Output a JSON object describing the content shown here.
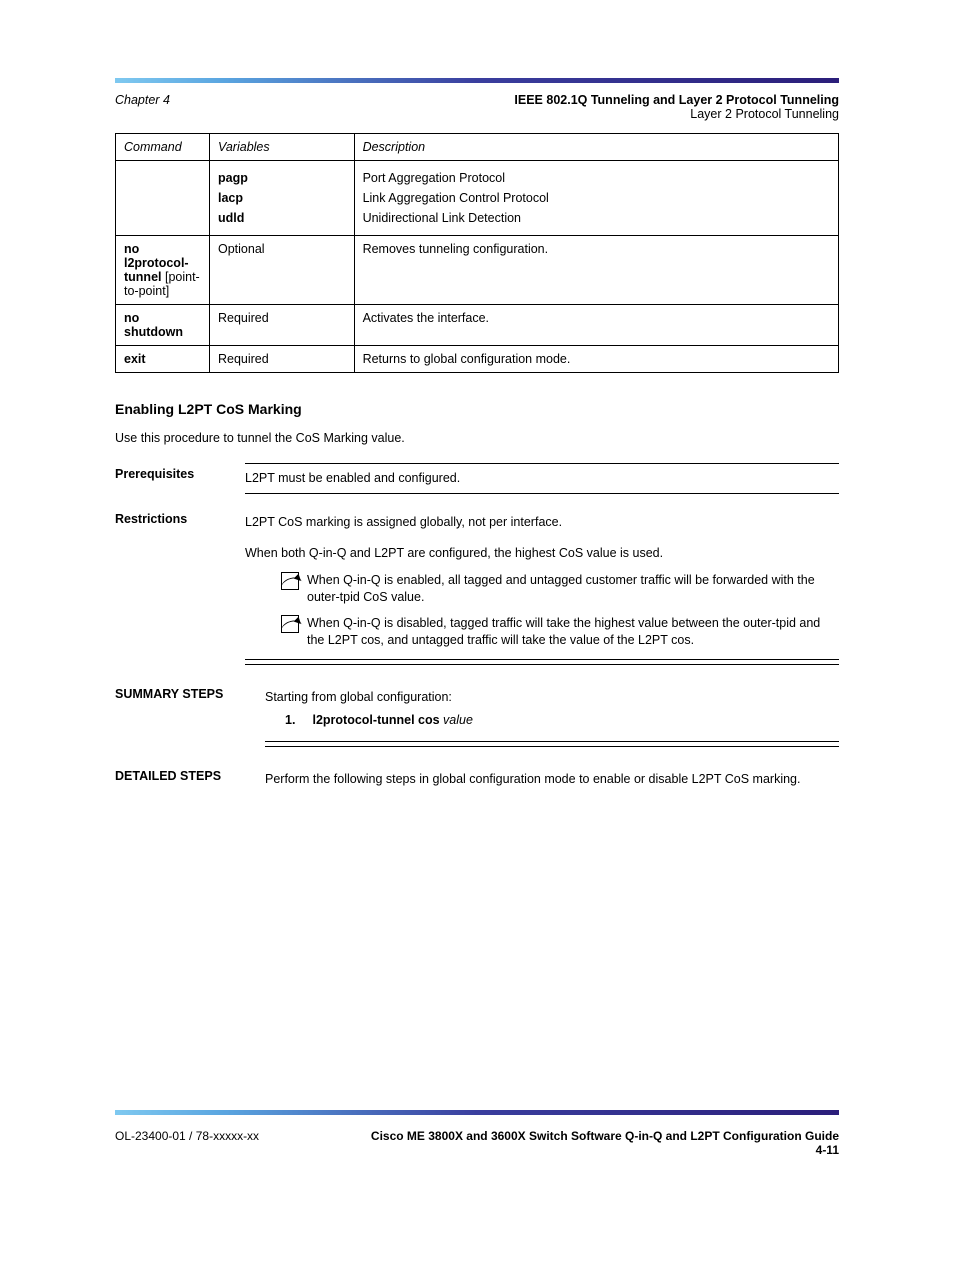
{
  "header": {
    "chapter": "Chapter 4",
    "section_title": "IEEE 802.1Q Tunneling and Layer 2 Protocol Tunneling",
    "subsection": "Layer 2 Protocol Tunneling"
  },
  "table": {
    "headers": [
      "Command",
      "Variables",
      "Description"
    ],
    "rows": [
      {
        "command": "",
        "variables_line1": "pagp",
        "variables_line2": "lacp",
        "variables_line3": "udld",
        "desc_line1": "Port Aggregation Protocol",
        "desc_line2": "Link Aggregation Control Protocol",
        "desc_line3": "Unidirectional Link Detection"
      },
      {
        "command_part1": "no l2protocol-tunnel",
        "command_part2": " [point-to-point]",
        "variables": "Optional",
        "desc": "Removes tunneling configuration."
      },
      {
        "command": "no shutdown",
        "variables": "Required",
        "desc": "Activates the interface."
      },
      {
        "command": "exit",
        "variables": "Required",
        "desc": "Returns to global configuration mode."
      }
    ]
  },
  "section_cos": {
    "heading": "Enabling L2PT CoS Marking",
    "intro": "Use this procedure to tunnel the CoS Marking value.",
    "prereq_label": "Prerequisites",
    "prereq_body": "L2PT must be enabled and configured.",
    "restr_label": "Restrictions",
    "restr_lines": [
      "L2PT CoS marking is assigned globally, not per interface.",
      "When both Q-in-Q and L2PT are configured, the highest CoS value is used."
    ],
    "restr_notes": [
      "When Q-in-Q is enabled, all tagged and untagged customer traffic will be forwarded with the outer-tpid CoS value.",
      "When Q-in-Q is disabled, tagged traffic will take the highest value between the outer-tpid and the L2PT cos, and untagged traffic will take the value of the L2PT cos."
    ],
    "sum_label": "SUMMARY STEPS",
    "sum_steps_lead": "Starting from global configuration:",
    "sum_steps": [
      {
        "n": "1.",
        "step_prefix": "l2protocol-tunnel cos",
        "step_suffix": " value"
      }
    ],
    "det_label": "DETAILED STEPS",
    "det_body": "Perform the following steps in global configuration mode to enable or disable L2PT CoS marking."
  },
  "footer": {
    "left": "OL-23400-01 / 78-xxxxx-xx",
    "title": "Cisco ME 3800X and 3600X Switch Software Q-in-Q and L2PT Configuration Guide",
    "page": "4-11"
  }
}
